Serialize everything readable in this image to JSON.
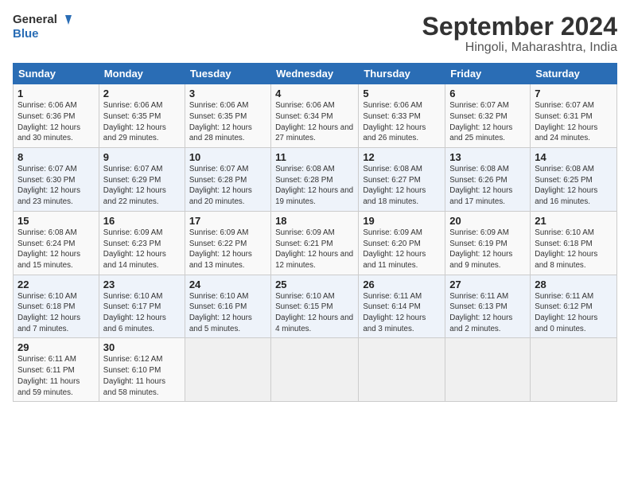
{
  "header": {
    "logo_line1": "General",
    "logo_line2": "Blue",
    "title": "September 2024",
    "subtitle": "Hingoli, Maharashtra, India"
  },
  "weekdays": [
    "Sunday",
    "Monday",
    "Tuesday",
    "Wednesday",
    "Thursday",
    "Friday",
    "Saturday"
  ],
  "weeks": [
    [
      {
        "day": "1",
        "sunrise": "6:06 AM",
        "sunset": "6:36 PM",
        "daylight": "12 hours and 30 minutes."
      },
      {
        "day": "2",
        "sunrise": "6:06 AM",
        "sunset": "6:35 PM",
        "daylight": "12 hours and 29 minutes."
      },
      {
        "day": "3",
        "sunrise": "6:06 AM",
        "sunset": "6:35 PM",
        "daylight": "12 hours and 28 minutes."
      },
      {
        "day": "4",
        "sunrise": "6:06 AM",
        "sunset": "6:34 PM",
        "daylight": "12 hours and 27 minutes."
      },
      {
        "day": "5",
        "sunrise": "6:06 AM",
        "sunset": "6:33 PM",
        "daylight": "12 hours and 26 minutes."
      },
      {
        "day": "6",
        "sunrise": "6:07 AM",
        "sunset": "6:32 PM",
        "daylight": "12 hours and 25 minutes."
      },
      {
        "day": "7",
        "sunrise": "6:07 AM",
        "sunset": "6:31 PM",
        "daylight": "12 hours and 24 minutes."
      }
    ],
    [
      {
        "day": "8",
        "sunrise": "6:07 AM",
        "sunset": "6:30 PM",
        "daylight": "12 hours and 23 minutes."
      },
      {
        "day": "9",
        "sunrise": "6:07 AM",
        "sunset": "6:29 PM",
        "daylight": "12 hours and 22 minutes."
      },
      {
        "day": "10",
        "sunrise": "6:07 AM",
        "sunset": "6:28 PM",
        "daylight": "12 hours and 20 minutes."
      },
      {
        "day": "11",
        "sunrise": "6:08 AM",
        "sunset": "6:28 PM",
        "daylight": "12 hours and 19 minutes."
      },
      {
        "day": "12",
        "sunrise": "6:08 AM",
        "sunset": "6:27 PM",
        "daylight": "12 hours and 18 minutes."
      },
      {
        "day": "13",
        "sunrise": "6:08 AM",
        "sunset": "6:26 PM",
        "daylight": "12 hours and 17 minutes."
      },
      {
        "day": "14",
        "sunrise": "6:08 AM",
        "sunset": "6:25 PM",
        "daylight": "12 hours and 16 minutes."
      }
    ],
    [
      {
        "day": "15",
        "sunrise": "6:08 AM",
        "sunset": "6:24 PM",
        "daylight": "12 hours and 15 minutes."
      },
      {
        "day": "16",
        "sunrise": "6:09 AM",
        "sunset": "6:23 PM",
        "daylight": "12 hours and 14 minutes."
      },
      {
        "day": "17",
        "sunrise": "6:09 AM",
        "sunset": "6:22 PM",
        "daylight": "12 hours and 13 minutes."
      },
      {
        "day": "18",
        "sunrise": "6:09 AM",
        "sunset": "6:21 PM",
        "daylight": "12 hours and 12 minutes."
      },
      {
        "day": "19",
        "sunrise": "6:09 AM",
        "sunset": "6:20 PM",
        "daylight": "12 hours and 11 minutes."
      },
      {
        "day": "20",
        "sunrise": "6:09 AM",
        "sunset": "6:19 PM",
        "daylight": "12 hours and 9 minutes."
      },
      {
        "day": "21",
        "sunrise": "6:10 AM",
        "sunset": "6:18 PM",
        "daylight": "12 hours and 8 minutes."
      }
    ],
    [
      {
        "day": "22",
        "sunrise": "6:10 AM",
        "sunset": "6:18 PM",
        "daylight": "12 hours and 7 minutes."
      },
      {
        "day": "23",
        "sunrise": "6:10 AM",
        "sunset": "6:17 PM",
        "daylight": "12 hours and 6 minutes."
      },
      {
        "day": "24",
        "sunrise": "6:10 AM",
        "sunset": "6:16 PM",
        "daylight": "12 hours and 5 minutes."
      },
      {
        "day": "25",
        "sunrise": "6:10 AM",
        "sunset": "6:15 PM",
        "daylight": "12 hours and 4 minutes."
      },
      {
        "day": "26",
        "sunrise": "6:11 AM",
        "sunset": "6:14 PM",
        "daylight": "12 hours and 3 minutes."
      },
      {
        "day": "27",
        "sunrise": "6:11 AM",
        "sunset": "6:13 PM",
        "daylight": "12 hours and 2 minutes."
      },
      {
        "day": "28",
        "sunrise": "6:11 AM",
        "sunset": "6:12 PM",
        "daylight": "12 hours and 0 minutes."
      }
    ],
    [
      {
        "day": "29",
        "sunrise": "6:11 AM",
        "sunset": "6:11 PM",
        "daylight": "11 hours and 59 minutes."
      },
      {
        "day": "30",
        "sunrise": "6:12 AM",
        "sunset": "6:10 PM",
        "daylight": "11 hours and 58 minutes."
      },
      null,
      null,
      null,
      null,
      null
    ]
  ]
}
